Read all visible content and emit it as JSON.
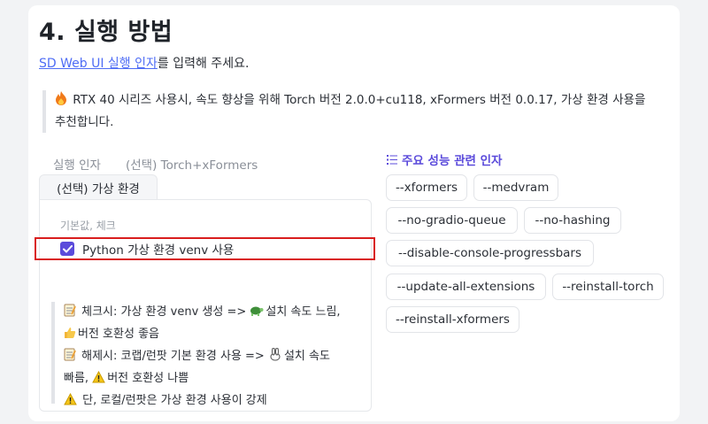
{
  "section": {
    "title": "4. 실행 방법",
    "intro_link": "SD Web UI 실행 인자",
    "intro_rest": "를 입력해 주세요."
  },
  "tip": {
    "icon": "fire-icon",
    "line1": "RTX 40 시리즈 사용시, 속도 향상을 위해 Torch 버전 2.0.0+cu118, xFormers 버전 0.0.17, 가상 환경 사용을",
    "line2": "추천합니다."
  },
  "tabs": {
    "items": [
      "실행 인자",
      "(선택) Torch+xFormers"
    ],
    "active": "(선택) 가상 환경"
  },
  "options": {
    "group_label": "기본값, 체크",
    "checkbox_label": "Python 가상 환경 venv 사용",
    "checked": true
  },
  "notes": {
    "line1": "체크시: 가상 환경 venv 생성 =>",
    "line1_tail": "설치 속도 느림,",
    "line2": "버전 호환성 좋음",
    "line3": "해제시: 코랩/런팟 기본 환경 사용 =>",
    "line3_tail": "설치 속도",
    "line4a": "빠름,",
    "line4b": "버전 호환성 나쁨",
    "line5": "단, 로컬/런팟은 가상 환경 사용이 강제"
  },
  "performance": {
    "title": "주요 성능 관련 인자",
    "args": [
      "--xformers",
      "--medvram",
      "--no-gradio-queue",
      "--no-hashing",
      "--disable-console-progressbars",
      "--update-all-extensions",
      "--reinstall-torch",
      "--reinstall-xformers"
    ]
  },
  "colors": {
    "accent": "#5b4bdb",
    "link": "#4f6df5",
    "highlight_border": "#d91e1e"
  }
}
